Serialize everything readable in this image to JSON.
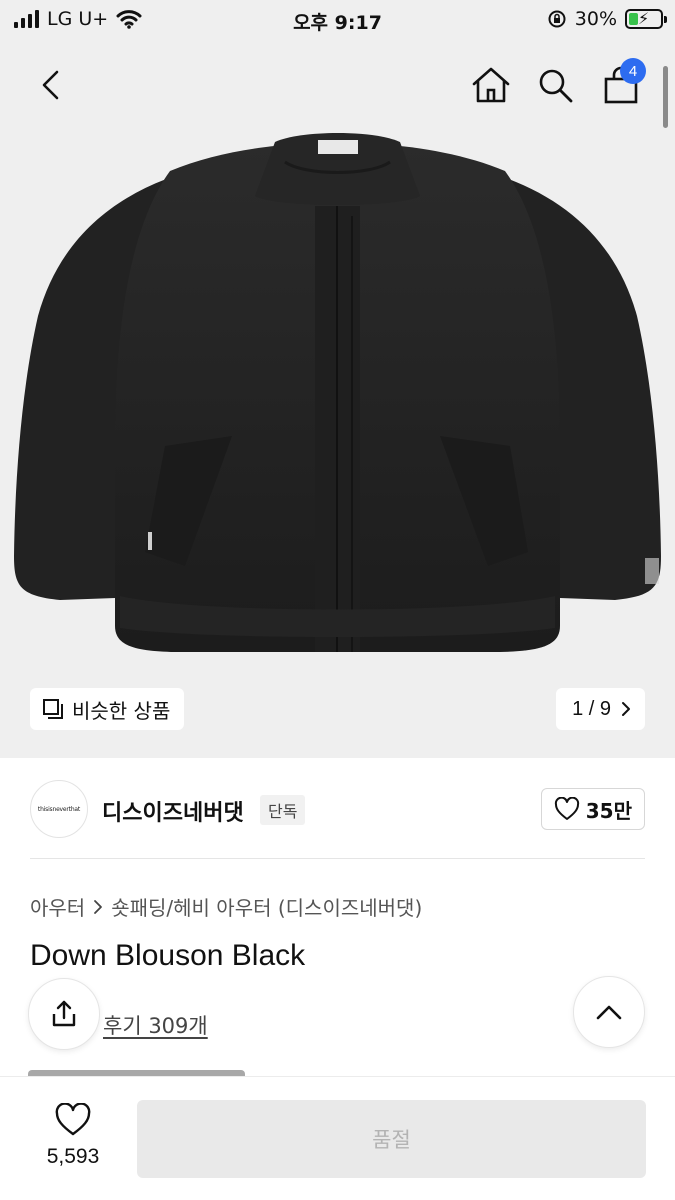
{
  "status_bar": {
    "carrier": "LG U+",
    "time": "오후 9:17",
    "battery_percent": "30%",
    "battery_level": 0.3,
    "icons": [
      "signal-icon",
      "wifi-icon",
      "orientation-lock-icon",
      "battery-charging-icon"
    ]
  },
  "nav": {
    "cart_count": "4",
    "icons": [
      "back-icon",
      "home-icon",
      "search-icon",
      "cart-icon"
    ],
    "accent_color": "#2d6cf0"
  },
  "gallery": {
    "similar_label": "비슷한 상품",
    "pager": "1 / 9"
  },
  "brand": {
    "logo_text": "thisisneverthat",
    "name": "디스이즈네버댓",
    "tag": "단독",
    "like_count": "35만"
  },
  "product": {
    "breadcrumb": [
      "아우터",
      "숏패딩/헤비 아우터 (디스이즈네버댓)"
    ],
    "title": "Down Blouson Black",
    "review_link": "후기 309개"
  },
  "bottom_bar": {
    "wish_count": "5,593",
    "soldout_label": "품절"
  }
}
